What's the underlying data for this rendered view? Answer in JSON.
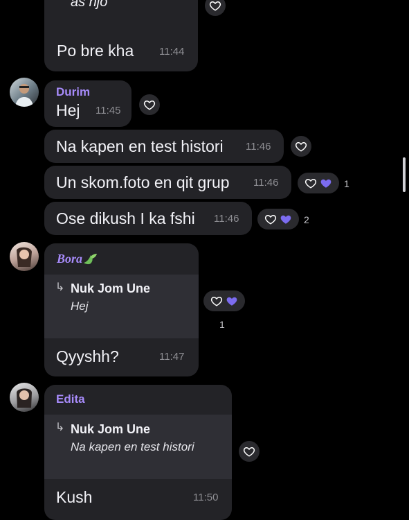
{
  "messages": [
    {
      "text": "as njo",
      "time": ""
    },
    {
      "text": "Po bre kha",
      "time": "11:44"
    },
    {
      "sender": "Durim",
      "text": "Hej",
      "time": "11:45"
    },
    {
      "text": "Na kapen en test histori",
      "time": "11:46"
    },
    {
      "text": "Un skom.foto en qit grup",
      "time": "11:46",
      "reactions": "1"
    },
    {
      "text": "Ose dikush I ka fshi",
      "time": "11:46",
      "reactions": "2"
    },
    {
      "sender": "Bora",
      "reply": {
        "author": "Nuk Jom Une",
        "text": "Hej"
      },
      "text": "Qyyshh?",
      "time": "11:47",
      "reactions": "1"
    },
    {
      "sender": "Edita",
      "reply": {
        "author": "Nuk Jom Une",
        "text": "Na kapen en test histori"
      },
      "text": "Kush",
      "time": "11:50"
    }
  ],
  "reply_arrow": "↳",
  "colors": {
    "background": "#000000",
    "bubble": "#232327",
    "quote": "#2f2f35",
    "accent": "#a78bfa",
    "heart_filled": "#7c6cf0"
  },
  "icons": {
    "reaction": "heart-outline-icon",
    "reaction_filled": "heart-filled-icon",
    "leaf": "leaf-icon"
  }
}
